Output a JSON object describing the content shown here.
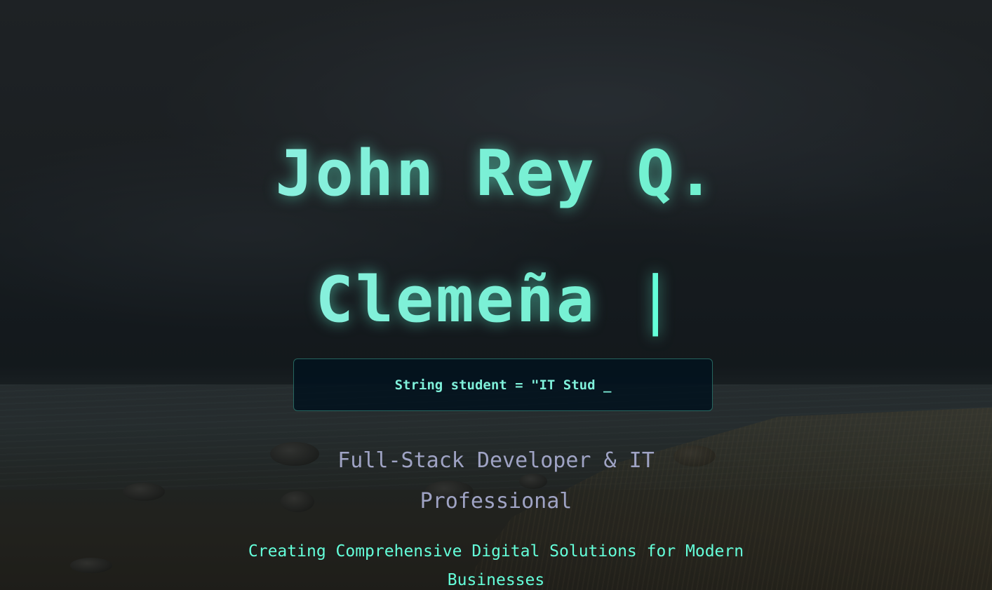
{
  "hero": {
    "name_line1": "John Rey Q.",
    "name_line2": "Clemeña",
    "cursor": "|",
    "code_snippet": "String student = \"IT Stud _",
    "subtitle": "Full-Stack Developer & IT Professional",
    "tagline": "Creating Comprehensive Digital Solutions for Modern Businesses"
  },
  "colors": {
    "accent": "#64ffda",
    "subtitle": "#9fa3c4",
    "code_box_bg": "#02121e"
  }
}
